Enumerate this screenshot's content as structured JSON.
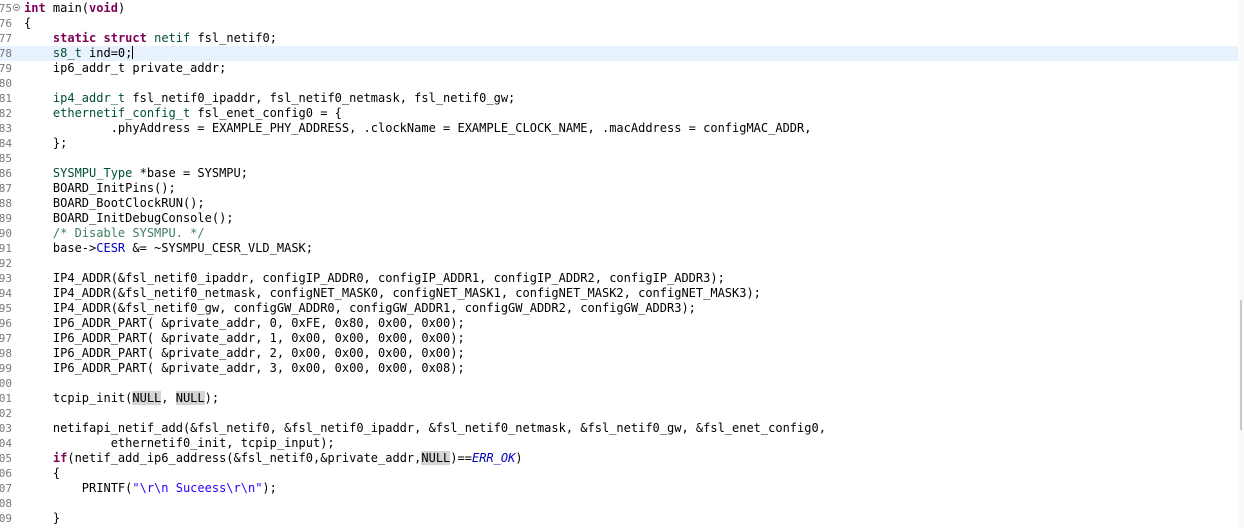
{
  "editor": {
    "language": "c",
    "current_line": "78",
    "lines": [
      {
        "num": "75",
        "fold": true,
        "tokens": [
          {
            "t": "int",
            "c": "kw"
          },
          {
            "t": " main("
          },
          {
            "t": "void",
            "c": "kw"
          },
          {
            "t": ")"
          }
        ]
      },
      {
        "num": "76",
        "tokens": [
          {
            "t": "{"
          }
        ]
      },
      {
        "num": "77",
        "tokens": [
          {
            "t": "    "
          },
          {
            "t": "static",
            "c": "kw"
          },
          {
            "t": " "
          },
          {
            "t": "struct",
            "c": "kw"
          },
          {
            "t": " "
          },
          {
            "t": "netif",
            "c": "ty"
          },
          {
            "t": " fsl_netif0;"
          }
        ]
      },
      {
        "num": "78",
        "current": true,
        "tokens": [
          {
            "t": "    "
          },
          {
            "t": "s8_t",
            "c": "ty"
          },
          {
            "t": " ind=0;"
          },
          {
            "caret": true
          }
        ]
      },
      {
        "num": "79",
        "tokens": [
          {
            "t": "    ip6_addr_t private_addr;"
          }
        ]
      },
      {
        "num": "80",
        "tokens": []
      },
      {
        "num": "81",
        "tokens": [
          {
            "t": "    "
          },
          {
            "t": "ip4_addr_t",
            "c": "ty"
          },
          {
            "t": " fsl_netif0_ipaddr, fsl_netif0_netmask, fsl_netif0_gw;"
          }
        ]
      },
      {
        "num": "82",
        "tokens": [
          {
            "t": "    "
          },
          {
            "t": "ethernetif_config_t",
            "c": "ty"
          },
          {
            "t": " fsl_enet_config0 = {"
          }
        ]
      },
      {
        "num": "83",
        "tokens": [
          {
            "t": "            .phyAddress = EXAMPLE_PHY_ADDRESS, .clockName = EXAMPLE_CLOCK_NAME, .macAddress = configMAC_ADDR,"
          }
        ]
      },
      {
        "num": "84",
        "tokens": [
          {
            "t": "    };"
          }
        ]
      },
      {
        "num": "85",
        "tokens": []
      },
      {
        "num": "86",
        "tokens": [
          {
            "t": "    "
          },
          {
            "t": "SYSMPU_Type",
            "c": "ty"
          },
          {
            "t": " *base = SYSMPU;"
          }
        ]
      },
      {
        "num": "87",
        "tokens": [
          {
            "t": "    BOARD_InitPins();"
          }
        ]
      },
      {
        "num": "88",
        "tokens": [
          {
            "t": "    BOARD_BootClockRUN();"
          }
        ]
      },
      {
        "num": "89",
        "tokens": [
          {
            "t": "    BOARD_InitDebugConsole();"
          }
        ]
      },
      {
        "num": "90",
        "tokens": [
          {
            "t": "    "
          },
          {
            "t": "/* Disable SYSMPU. */",
            "c": "cm"
          }
        ]
      },
      {
        "num": "91",
        "tokens": [
          {
            "t": "    base->"
          },
          {
            "t": "CESR",
            "c": "fld"
          },
          {
            "t": " &= ~SYSMPU_CESR_VLD_MASK;"
          }
        ]
      },
      {
        "num": "92",
        "tokens": []
      },
      {
        "num": "93",
        "tokens": [
          {
            "t": "    IP4_ADDR(&fsl_netif0_ipaddr, configIP_ADDR0, configIP_ADDR1, configIP_ADDR2, configIP_ADDR3);"
          }
        ]
      },
      {
        "num": "94",
        "tokens": [
          {
            "t": "    IP4_ADDR(&fsl_netif0_netmask, configNET_MASK0, configNET_MASK1, configNET_MASK2, configNET_MASK3);"
          }
        ]
      },
      {
        "num": "95",
        "tokens": [
          {
            "t": "    IP4_ADDR(&fsl_netif0_gw, configGW_ADDR0, configGW_ADDR1, configGW_ADDR2, configGW_ADDR3);"
          }
        ]
      },
      {
        "num": "96",
        "tokens": [
          {
            "t": "    IP6_ADDR_PART( &private_addr, 0, 0xFE, 0x80, 0x00, 0x00);"
          }
        ]
      },
      {
        "num": "97",
        "tokens": [
          {
            "t": "    IP6_ADDR_PART( &private_addr, 1, 0x00, 0x00, 0x00, 0x00);"
          }
        ]
      },
      {
        "num": "98",
        "tokens": [
          {
            "t": "    IP6_ADDR_PART( &private_addr, 2, 0x00, 0x00, 0x00, 0x00);"
          }
        ]
      },
      {
        "num": "99",
        "tokens": [
          {
            "t": "    IP6_ADDR_PART( &private_addr, 3, 0x00, 0x00, 0x00, 0x08);"
          }
        ]
      },
      {
        "num": "00",
        "tokens": []
      },
      {
        "num": "01",
        "tokens": [
          {
            "t": "    tcpip_init("
          },
          {
            "t": "NULL",
            "c": "hl"
          },
          {
            "t": ", "
          },
          {
            "t": "NULL",
            "c": "hl"
          },
          {
            "t": ");"
          }
        ]
      },
      {
        "num": "02",
        "tokens": []
      },
      {
        "num": "03",
        "tokens": [
          {
            "t": "    netifapi_netif_add(&fsl_netif0, &fsl_netif0_ipaddr, &fsl_netif0_netmask, &fsl_netif0_gw, &fsl_enet_config0,"
          }
        ]
      },
      {
        "num": "04",
        "tokens": [
          {
            "t": "            ethernetif0_init, tcpip_input);"
          }
        ]
      },
      {
        "num": "05",
        "tokens": [
          {
            "t": "    "
          },
          {
            "t": "if",
            "c": "kw"
          },
          {
            "t": "(netif_add_ip6_address(&fsl_netif0,&private_addr,"
          },
          {
            "t": "NULL",
            "c": "hl"
          },
          {
            "t": ")=="
          },
          {
            "t": "ERR_OK",
            "c": "it"
          },
          {
            "t": ")"
          }
        ]
      },
      {
        "num": "06",
        "tokens": [
          {
            "t": "    {"
          }
        ]
      },
      {
        "num": "07",
        "tokens": [
          {
            "t": "        PRINTF("
          },
          {
            "t": "\"\\r\\n Suceess\\r\\n\"",
            "c": "st"
          },
          {
            "t": ");"
          }
        ]
      },
      {
        "num": "08",
        "tokens": []
      },
      {
        "num": "09",
        "tokens": [
          {
            "t": "    }"
          }
        ]
      }
    ]
  }
}
